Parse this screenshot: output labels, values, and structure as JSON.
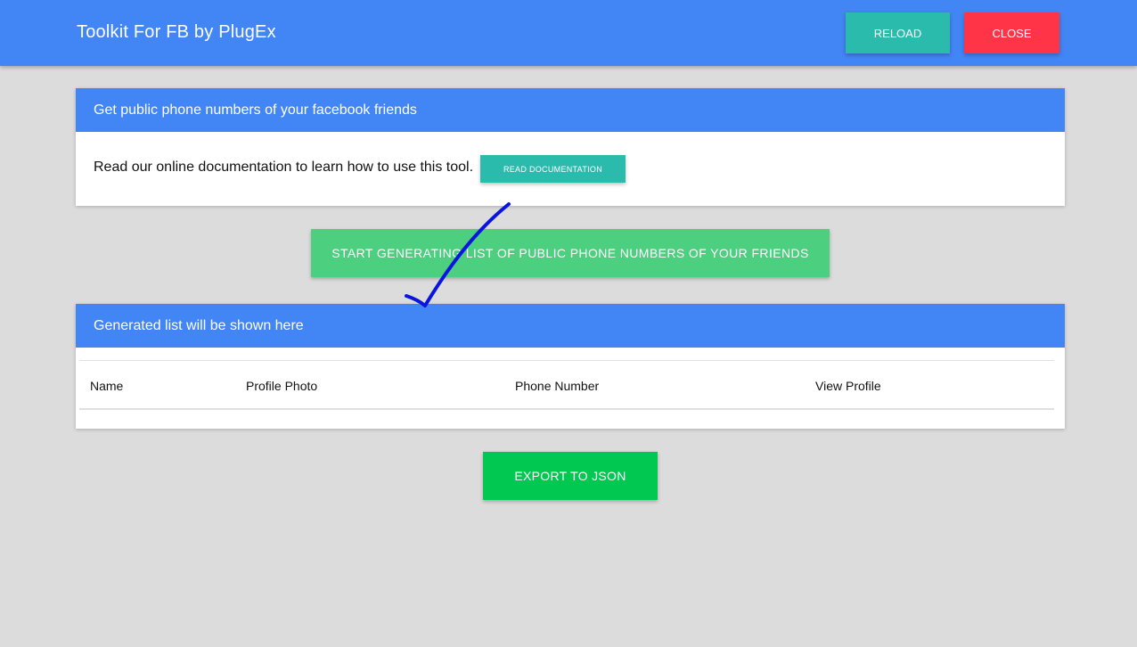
{
  "header": {
    "title": "Toolkit For FB by PlugEx",
    "reload_label": "RELOAD",
    "close_label": "CLOSE"
  },
  "docs_card": {
    "title": "Get public phone numbers of your facebook friends",
    "body_text": "Read our online documentation to learn how to use this tool.",
    "docs_button_label": "READ DOCUMENTATION"
  },
  "start_button_label": "START GENERATING LIST OF PUBLIC PHONE NUMBERS OF YOUR FRIENDS",
  "results_card": {
    "title": "Generated list will be shown here",
    "columns": [
      "Name",
      "Profile Photo",
      "Phone Number",
      "View Profile"
    ]
  },
  "export_button_label": "EXPORT TO JSON",
  "colors": {
    "primary": "#4285f4",
    "teal": "#2bbbad",
    "danger": "#ff3547",
    "success": "#00c851",
    "success_light": "#4ccf7f",
    "annotation": "#0a14e0"
  }
}
